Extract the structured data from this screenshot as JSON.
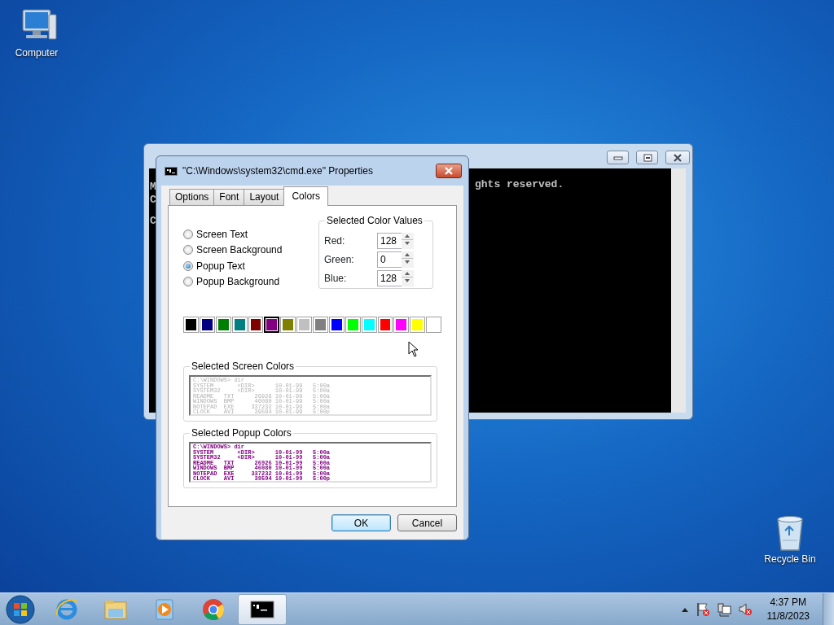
{
  "desktop_icons": [
    {
      "kind": "computer",
      "label": "Computer"
    },
    {
      "kind": "recycle",
      "label": "Recycle Bin"
    }
  ],
  "console_window": {
    "left_chars": [
      "M",
      "C",
      "C"
    ],
    "visible_text": "ghts reserved."
  },
  "dialog": {
    "title": "\"C:\\Windows\\system32\\cmd.exe\" Properties",
    "tabs": [
      {
        "label": "Options",
        "selected": false
      },
      {
        "label": "Font",
        "selected": false
      },
      {
        "label": "Layout",
        "selected": false
      },
      {
        "label": "Colors",
        "selected": true
      }
    ],
    "targets": [
      {
        "label": "Screen Text",
        "selected": false
      },
      {
        "label": "Screen Background",
        "selected": false
      },
      {
        "label": "Popup Text",
        "selected": true
      },
      {
        "label": "Popup Background",
        "selected": false
      }
    ],
    "color_values": {
      "legend": "Selected Color Values",
      "fields": [
        {
          "label": "Red:",
          "value": "128"
        },
        {
          "label": "Green:",
          "value": "0"
        },
        {
          "label": "Blue:",
          "value": "128"
        }
      ]
    },
    "palette": [
      {
        "color": "#000000",
        "selected": false
      },
      {
        "color": "#000080",
        "selected": false
      },
      {
        "color": "#008000",
        "selected": false
      },
      {
        "color": "#008080",
        "selected": false
      },
      {
        "color": "#800000",
        "selected": false
      },
      {
        "color": "#800080",
        "selected": true
      },
      {
        "color": "#808000",
        "selected": false
      },
      {
        "color": "#c0c0c0",
        "selected": false
      },
      {
        "color": "#808080",
        "selected": false
      },
      {
        "color": "#0000ff",
        "selected": false
      },
      {
        "color": "#00ff00",
        "selected": false
      },
      {
        "color": "#00ffff",
        "selected": false
      },
      {
        "color": "#ff0000",
        "selected": false
      },
      {
        "color": "#ff00ff",
        "selected": false
      },
      {
        "color": "#ffff00",
        "selected": false
      },
      {
        "color": "#ffffff",
        "selected": false
      }
    ],
    "previews": [
      {
        "kind": "screen",
        "legend": "Selected Screen Colors",
        "lines": [
          "C:\\WINDOWS> dir",
          "SYSTEM       <DIR>      10-01-99   5:00a",
          "SYSTEM32     <DIR>      10-01-99   5:00a",
          "README   TXT      26926 10-01-99   5:00a",
          "WINDOWS  BMP      46080 10-01-99   5:00a",
          "NOTEPAD  EXE     337232 10-01-99   5:00a",
          "CLOCK    AVI      39594 10-01-99   5:00p"
        ]
      },
      {
        "kind": "popup",
        "legend": "Selected Popup Colors",
        "lines": [
          "C:\\WINDOWS> dir",
          "SYSTEM       <DIR>      10-01-99   5:00a",
          "SYSTEM32     <DIR>      10-01-99   5:00a",
          "README   TXT      26926 10-01-99   5:00a",
          "WINDOWS  BMP      46080 10-01-99   5:00a",
          "NOTEPAD  EXE     337232 10-01-99   5:00a",
          "CLOCK    AVI      39594 10-01-99   5:00p"
        ]
      }
    ],
    "buttons": [
      {
        "label": "OK",
        "default": true
      },
      {
        "label": "Cancel",
        "default": false
      }
    ]
  },
  "taskbar": {
    "items": [
      {
        "kind": "ie",
        "active": false
      },
      {
        "kind": "folder",
        "active": false
      },
      {
        "kind": "media",
        "active": false
      },
      {
        "kind": "chrome",
        "active": false
      },
      {
        "kind": "console",
        "active": true
      }
    ],
    "time": "4:37 PM",
    "date": "11/8/2023"
  }
}
